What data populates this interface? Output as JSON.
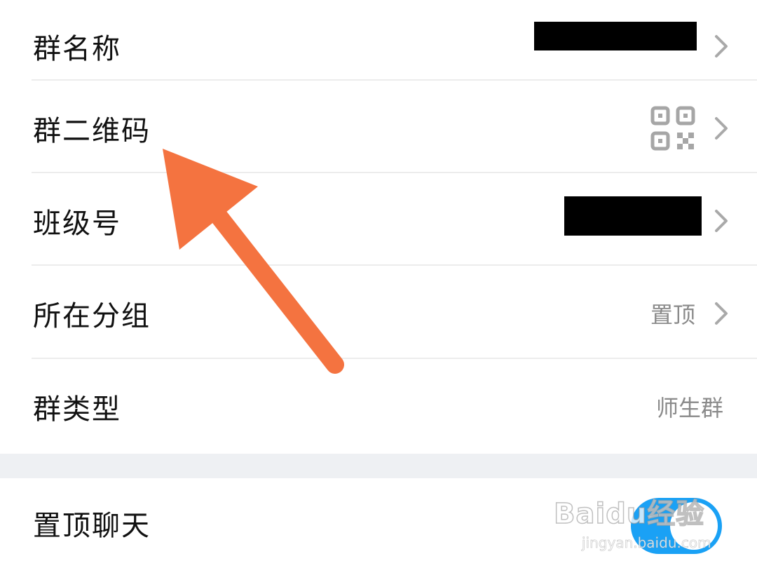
{
  "settings": {
    "rows": [
      {
        "label": "群名称",
        "value": "",
        "redacted": true,
        "chevron": true
      },
      {
        "label": "群二维码",
        "value": "",
        "icon": "qr-code-icon",
        "chevron": true
      },
      {
        "label": "班级号",
        "value": "",
        "redacted": true,
        "chevron": true
      },
      {
        "label": "所在分组",
        "value": "置顶",
        "chevron": true
      },
      {
        "label": "群类型",
        "value": "师生群",
        "chevron": false
      }
    ],
    "toggle_row": {
      "label": "置顶聊天",
      "toggle_on": true
    }
  },
  "annotation": {
    "arrow_color": "#f47340",
    "points_to": "群二维码"
  },
  "watermark": {
    "logo_text": "Baidu经验",
    "url_text": "jingyan.baidu.com"
  },
  "colors": {
    "accent_toggle": "#1aa1f5",
    "divider": "#ececec",
    "section_gap": "#eef0f3"
  }
}
